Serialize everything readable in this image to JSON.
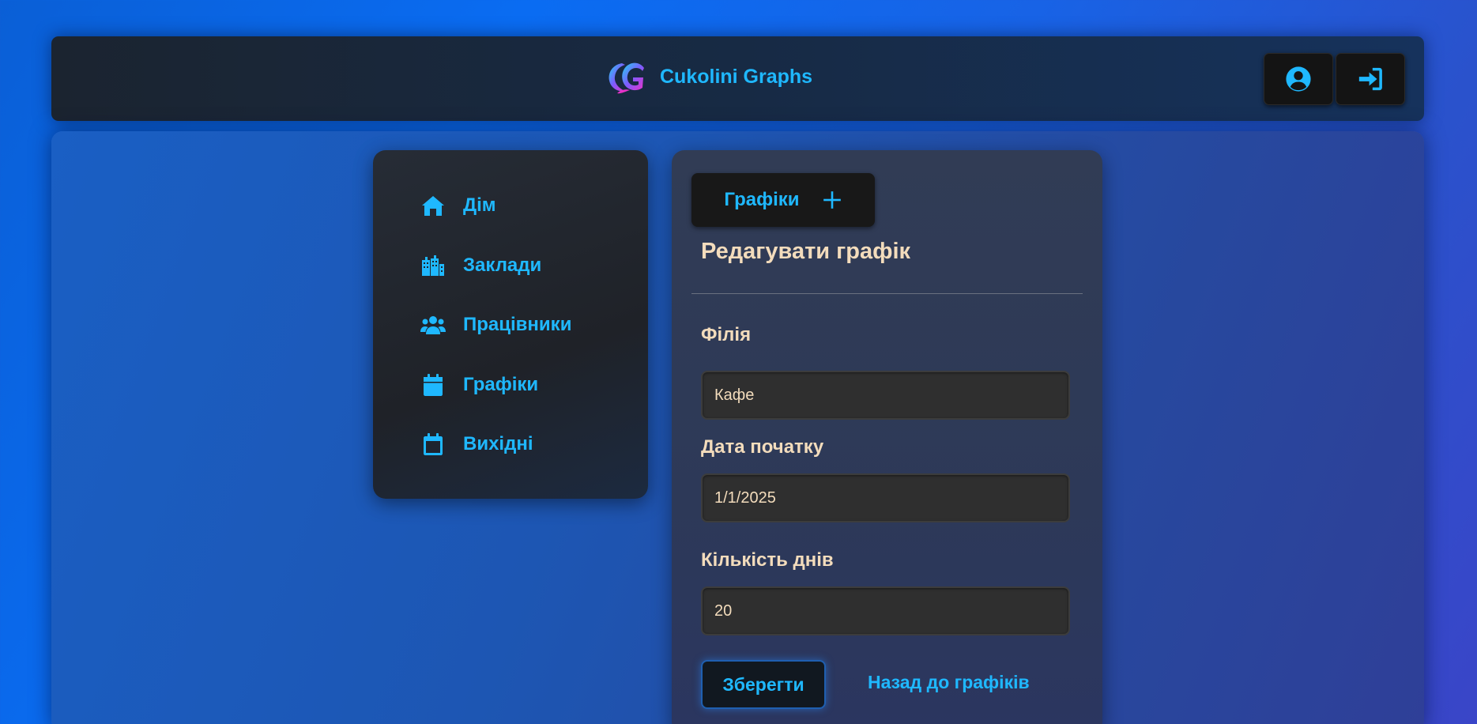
{
  "header": {
    "brand_name": "Cukolini Graphs",
    "logo_icon": "cg-logo-icon",
    "profile_icon": "user-circle-icon",
    "login_icon": "sign-in-icon"
  },
  "sidebar": {
    "items": [
      {
        "label": "Дім",
        "icon": "home-icon"
      },
      {
        "label": "Заклади",
        "icon": "city-icon"
      },
      {
        "label": "Працівники",
        "icon": "users-icon"
      },
      {
        "label": "Графіки",
        "icon": "calendar-icon"
      },
      {
        "label": "Вихідні",
        "icon": "calendar-outline-icon"
      }
    ]
  },
  "tab": {
    "label": "Графіки",
    "icon": "plus-icon"
  },
  "form": {
    "title": "Редагувати графік",
    "branch": {
      "label": "Філія",
      "value": "Кафе"
    },
    "start_date": {
      "label": "Дата початку",
      "value": "1/1/2025"
    },
    "days_count": {
      "label": "Кількість днів",
      "value": "20"
    },
    "save_label": "Зберегти",
    "back_label": "Назад до графіків"
  },
  "colors": {
    "accent": "#1fb8ff",
    "text_warm": "#f3dcbc",
    "dark_panel": "#1f2228",
    "input_bg": "#2f2f2f"
  }
}
